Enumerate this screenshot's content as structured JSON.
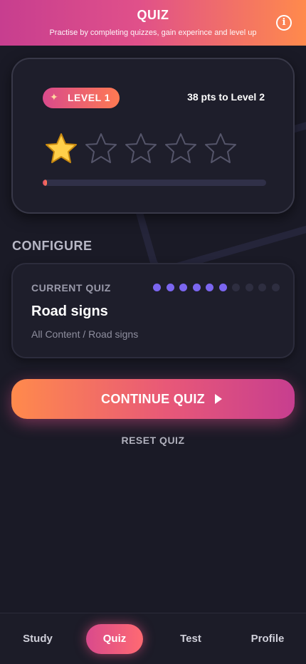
{
  "header": {
    "title": "QUIZ",
    "subtitle": "Practise by completing quizzes, gain experince and level up",
    "info_icon": "info-icon"
  },
  "level_card": {
    "level_label": "LEVEL 1",
    "sparkle_icon": "sparkles-icon",
    "points_to_next": "38 pts to Level 2",
    "stars_total": 5,
    "stars_filled": 1,
    "progress_fraction": 0.02
  },
  "configure": {
    "heading": "CONFIGURE",
    "current_quiz_label": "CURRENT QUIZ",
    "quiz_name": "Road signs",
    "quiz_path": "All Content / Road signs",
    "progress_dots_total": 10,
    "progress_dots_filled": 6
  },
  "actions": {
    "continue_label": "CONTINUE QUIZ",
    "reset_label": "RESET QUIZ"
  },
  "nav": {
    "items": [
      {
        "label": "Study",
        "active": false
      },
      {
        "label": "Quiz",
        "active": true
      },
      {
        "label": "Test",
        "active": false
      },
      {
        "label": "Profile",
        "active": false
      }
    ]
  },
  "colors": {
    "accent_pink": "#d94a8c",
    "accent_orange": "#ff8a4c",
    "dot_active": "#7b66f0",
    "star_filled": "#ffcf4a",
    "background": "#1a1a26"
  }
}
